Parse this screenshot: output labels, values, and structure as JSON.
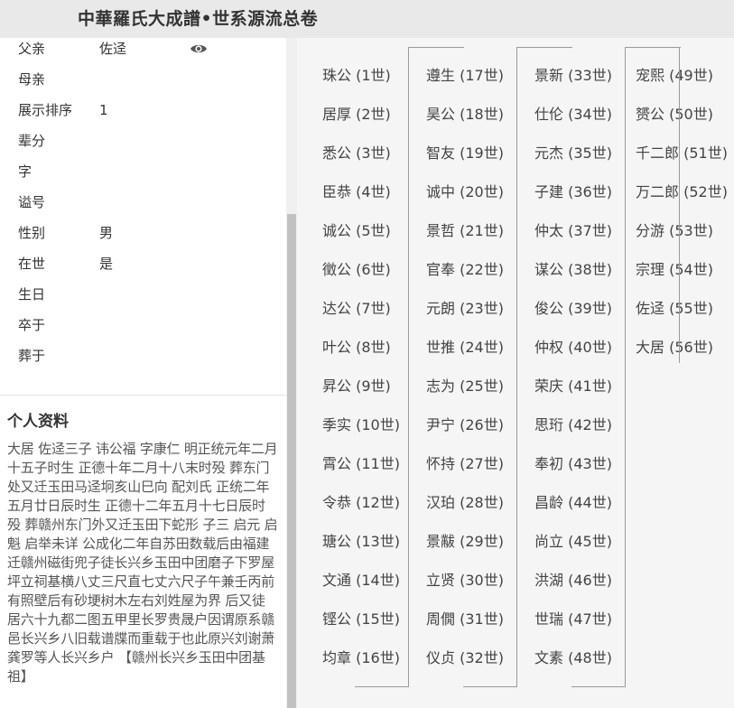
{
  "header": {
    "title": "中華羅氏大成譜•世系源流总卷"
  },
  "info": {
    "rows": [
      {
        "label": "父亲",
        "value": "佐迳"
      },
      {
        "label": "母亲",
        "value": ""
      },
      {
        "label": "展示排序",
        "value": "1"
      },
      {
        "label": "辈分",
        "value": ""
      },
      {
        "label": "字",
        "value": ""
      },
      {
        "label": "谥号",
        "value": ""
      },
      {
        "label": "性别",
        "value": "男"
      },
      {
        "label": "在世",
        "value": "是"
      },
      {
        "label": "生日",
        "value": ""
      },
      {
        "label": "卒于",
        "value": ""
      },
      {
        "label": "葬于",
        "value": ""
      }
    ],
    "eye_icon": "eye-icon"
  },
  "bio": {
    "title": "个人资料",
    "text": "大居 佐迳三子 讳公福 字康仁 明正统元年二月十五子时生 正德十年二月十八末时殁 葬东门处又迁玉田马迳坰亥山巳向 配刘氏 正统二年五月廿日辰时生 正德十二年五月十七日辰时殁 葬赣州东门外又迁玉田下蛇形 子三 启元 启魁 启举未详 公成化二年自苏田数载后由福建迁赣州磁街兜子徒长兴乡玉田中团磨子下罗屋坪立祠基横八丈三尺直七丈六尺子午兼壬丙前有照壁后有砂埂树木左右刘姓屋为界 后又徒居六十九都二图五甲里长罗贵晟户因谓原系赣邑长兴乡八旧载谱牒而重载于也此原兴刘谢萧龚罗等人长兴乡户 【赣州长兴乡玉田中团基祖】"
  },
  "tree": {
    "columns": [
      [
        "珠公 (1世)",
        "居厚 (2世)",
        "悉公 (3世)",
        "臣恭 (4世)",
        "诚公 (5世)",
        "徵公 (6世)",
        "达公 (7世)",
        "叶公 (8世)",
        "昇公 (9世)",
        "季实 (10世)",
        "霄公 (11世)",
        "令恭 (12世)",
        "瑭公 (13世)",
        "文通 (14世)",
        "铿公 (15世)",
        "均章 (16世)"
      ],
      [
        "遵生 (17世)",
        "昊公 (18世)",
        "智友 (19世)",
        "诚中 (20世)",
        "景哲 (21世)",
        "官奉 (22世)",
        "元朗 (23世)",
        "世推 (24世)",
        "志为 (25世)",
        "尹宁 (26世)",
        "怀持 (27世)",
        "汉珀 (28世)",
        "景黻 (29世)",
        "立贤 (30世)",
        "周僩 (31世)",
        "仪贞 (32世)"
      ],
      [
        "景新 (33世)",
        "仕伦 (34世)",
        "元杰 (35世)",
        "子建 (36世)",
        "仲太 (37世)",
        "谋公 (38世)",
        "俊公 (39世)",
        "仲权 (40世)",
        "荣庆 (41世)",
        "思珩 (42世)",
        "奉初 (43世)",
        "昌龄 (44世)",
        "尚立 (45世)",
        "洪湖 (46世)",
        "世瑞 (47世)",
        "文素 (48世)"
      ],
      [
        "宠熙 (49世)",
        "赟公 (50世)",
        "千二郎 (51世)",
        "万二郎 (52世)",
        "分游 (53世)",
        "宗理 (54世)",
        "佐迳 (55世)",
        "大居 (56世)"
      ]
    ]
  }
}
